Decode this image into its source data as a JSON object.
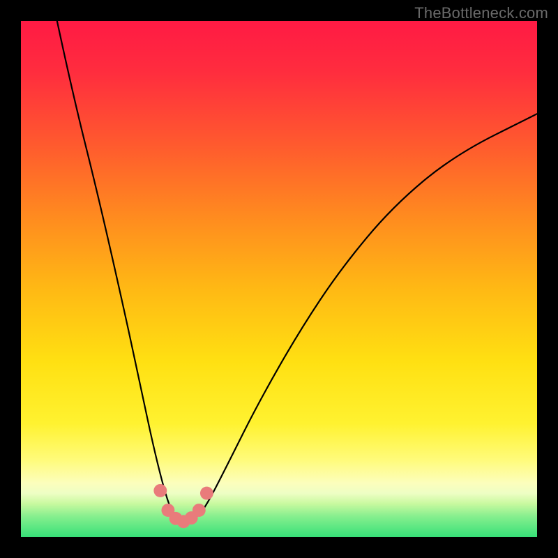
{
  "watermark": "TheBottleneck.com",
  "chart_data": {
    "type": "line",
    "title": "",
    "xlabel": "",
    "ylabel": "",
    "xlim": [
      0,
      100
    ],
    "ylim": [
      0,
      100
    ],
    "grid": false,
    "legend": false,
    "series": [
      {
        "name": "curve",
        "x": [
          7,
          10,
          15,
          20,
          23,
          26,
          28.5,
          30,
          32,
          34,
          36,
          40,
          46,
          54,
          62,
          72,
          84,
          100
        ],
        "y": [
          100,
          86,
          66,
          44,
          30,
          16,
          6.5,
          3.8,
          3.0,
          3.7,
          6.2,
          14,
          26,
          40,
          52,
          64,
          74,
          82
        ]
      }
    ],
    "markers": {
      "name": "minimum-cluster",
      "points": [
        {
          "x": 27.0,
          "y": 9.0,
          "r": 1.2
        },
        {
          "x": 28.5,
          "y": 5.2,
          "r": 1.2
        },
        {
          "x": 30.0,
          "y": 3.6,
          "r": 1.2
        },
        {
          "x": 31.5,
          "y": 3.0,
          "r": 1.2
        },
        {
          "x": 33.0,
          "y": 3.7,
          "r": 1.2
        },
        {
          "x": 34.5,
          "y": 5.2,
          "r": 1.2
        },
        {
          "x": 36.0,
          "y": 8.5,
          "r": 1.2
        }
      ]
    },
    "background_gradient": {
      "direction": "top-to-bottom",
      "stops": [
        {
          "pct": 0,
          "color": "#ff1a44"
        },
        {
          "pct": 38,
          "color": "#ff8b1f"
        },
        {
          "pct": 66,
          "color": "#ffe012"
        },
        {
          "pct": 90,
          "color": "#fcfebc"
        },
        {
          "pct": 100,
          "color": "#37e078"
        }
      ]
    }
  }
}
